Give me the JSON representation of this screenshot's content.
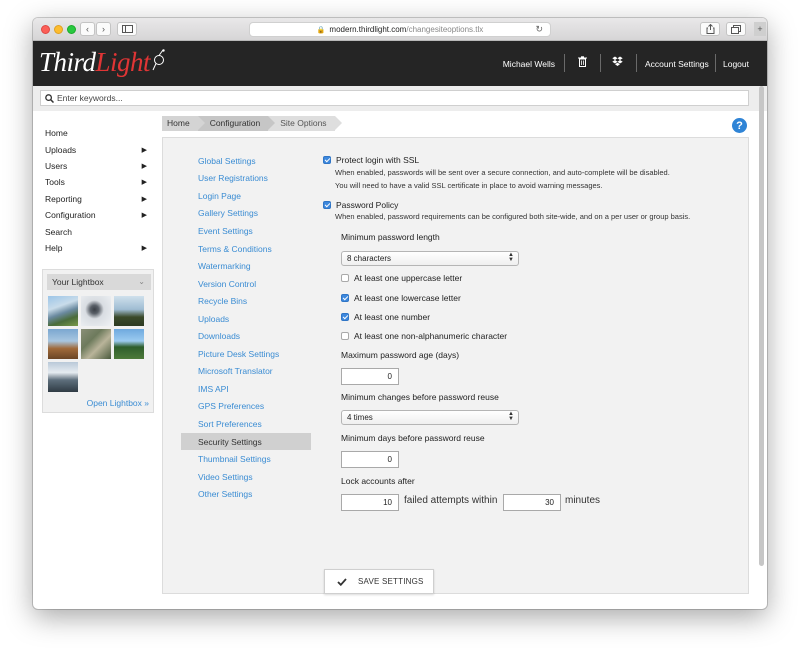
{
  "browser": {
    "url_host": "modern.thirdlight.com",
    "url_path": "/changesiteoptions.tlx"
  },
  "header": {
    "logo_word1": "Third",
    "logo_word2": "Light",
    "user_name": "Michael Wells",
    "account_settings": "Account Settings",
    "logout": "Logout"
  },
  "search": {
    "placeholder": "Enter keywords..."
  },
  "nav": {
    "items": [
      {
        "label": "Home",
        "has_submenu": false
      },
      {
        "label": "Uploads",
        "has_submenu": true
      },
      {
        "label": "Users",
        "has_submenu": true
      },
      {
        "label": "Tools",
        "has_submenu": true
      },
      {
        "label": "Reporting",
        "has_submenu": true
      },
      {
        "label": "Configuration",
        "has_submenu": true
      },
      {
        "label": "Search",
        "has_submenu": false
      },
      {
        "label": "Help",
        "has_submenu": true
      }
    ]
  },
  "lightbox": {
    "title": "Your Lightbox",
    "open_link": "Open Lightbox »"
  },
  "breadcrumb": [
    "Home",
    "Configuration",
    "Site Options"
  ],
  "subnav": {
    "items": [
      "Global Settings",
      "User Registrations",
      "Login Page",
      "Gallery Settings",
      "Event Settings",
      "Terms & Conditions",
      "Watermarking",
      "Version Control",
      "Recycle Bins",
      "Uploads",
      "Downloads",
      "Picture Desk Settings",
      "Microsoft Translator",
      "IMS API",
      "GPS Preferences",
      "Sort Preferences",
      "Security Settings",
      "Thumbnail Settings",
      "Video Settings",
      "Other Settings"
    ],
    "active": "Security Settings"
  },
  "security": {
    "ssl_label": "Protect login with SSL",
    "ssl_checked": true,
    "ssl_desc1": "When enabled, passwords will be sent over a secure connection, and auto-complete will be disabled.",
    "ssl_desc2": "You will need to have a valid SSL certificate in place to avoid warning messages.",
    "policy_label": "Password Policy",
    "policy_checked": true,
    "policy_desc": "When enabled, password requirements can be configured both site-wide, and on a per user or group basis.",
    "min_length_label": "Minimum password length",
    "min_length_value": "8 characters",
    "uppercase_label": "At least one uppercase letter",
    "uppercase_checked": false,
    "lowercase_label": "At least one lowercase letter",
    "lowercase_checked": true,
    "number_label": "At least one number",
    "number_checked": true,
    "nonalpha_label": "At least one non-alphanumeric character",
    "nonalpha_checked": false,
    "max_age_label": "Maximum password age (days)",
    "max_age_value": "0",
    "min_changes_label": "Minimum changes before password reuse",
    "min_changes_value": "4 times",
    "min_days_label": "Minimum days before password reuse",
    "min_days_value": "0",
    "lock_label": "Lock accounts after",
    "lock_attempts_value": "10",
    "lock_attempts_text": "failed attempts within",
    "lock_minutes_value": "30",
    "lock_minutes_text": "minutes"
  },
  "save_button": "SAVE SETTINGS",
  "colors": {
    "accent": "#3a8cd3",
    "logo_red": "#e03535",
    "header_bg": "#252525",
    "help": "#2f84d6"
  }
}
